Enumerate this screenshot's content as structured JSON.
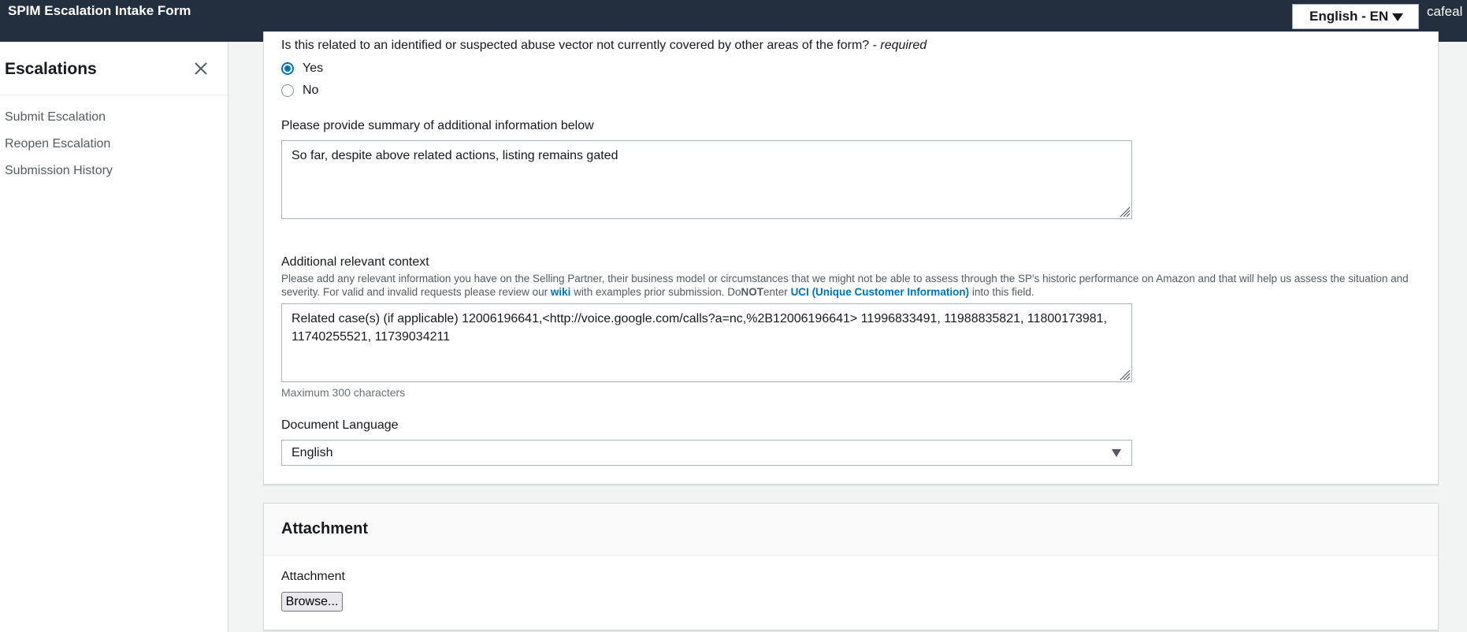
{
  "header": {
    "app_title": "SPIM Escalation Intake Form",
    "language_selector": "English - EN",
    "username": "cafeal"
  },
  "sidebar": {
    "title": "Escalations",
    "close_icon": "close-icon",
    "items": [
      {
        "label": "Submit Escalation"
      },
      {
        "label": "Reopen Escalation"
      },
      {
        "label": "Submission History"
      }
    ]
  },
  "form": {
    "abuse_vector": {
      "question": "Is this related to an identified or suspected abuse vector not currently covered by other areas of the form? - ",
      "required": "required",
      "options": [
        "Yes",
        "No"
      ],
      "selected": "Yes"
    },
    "summary": {
      "label": "Please provide summary of additional information below",
      "value": "So far, despite above related actions, listing remains gated"
    },
    "context": {
      "label": "Additional relevant context",
      "desc_1": "Please add any relevant information you have on the Selling Partner, their business model or circumstances that we might not be able to assess through the SP's historic performance on Amazon and that will help us assess the situation and severity. For valid and invalid requests please review our ",
      "wiki_link": "wiki",
      "desc_2": " with examples prior submission. Do",
      "desc_not": "NOT",
      "desc_3": "enter ",
      "uci_link": "UCI (Unique Customer Information)",
      "desc_4": " into this field.",
      "value": "Related case(s) (if applicable) 12006196641,<http://voice.google.com/calls?a=nc,%2B12006196641> 11996833491, 11988835821, 11800173981, 11740255521, 11739034211",
      "hint": "Maximum 300 characters"
    },
    "document_language": {
      "label": "Document Language",
      "value": "English"
    }
  },
  "attachment": {
    "section_title": "Attachment",
    "label": "Attachment",
    "browse_label": "Browse..."
  },
  "colors": {
    "topbar": "#232f3e",
    "link": "#0073bb",
    "radio_selected": "#0073bb"
  }
}
